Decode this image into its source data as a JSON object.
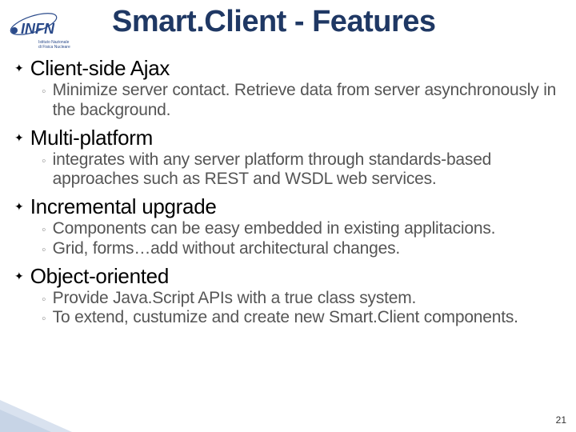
{
  "logo": {
    "top_label": "INFN",
    "bottom_label": "di Fisica Nucleare",
    "alt": "INFN logo"
  },
  "title": "Smart.Client - Features",
  "items": [
    {
      "heading": "Client-side Ajax",
      "subs": [
        "Minimize server contact. Retrieve data from server asynchronously in the background."
      ]
    },
    {
      "heading": "Multi-platform",
      "subs": [
        "integrates with any server platform through standards-based approaches such as REST and WSDL web services."
      ]
    },
    {
      "heading": "Incremental upgrade",
      "subs": [
        "Components can be easy embedded in existing applitacions.",
        "Grid, forms…add without architectural changes."
      ]
    },
    {
      "heading": "Object-oriented",
      "subs": [
        "Provide Java.Script APIs with a true class system.",
        "To extend, custumize and create new Smart.Client components."
      ]
    }
  ],
  "page_number": "21",
  "glyphs": {
    "bullet1": "✦",
    "bullet2": "◦"
  },
  "colors": {
    "title": "#1f3864",
    "subtext": "#555555",
    "accent": "#c7d4e6"
  }
}
